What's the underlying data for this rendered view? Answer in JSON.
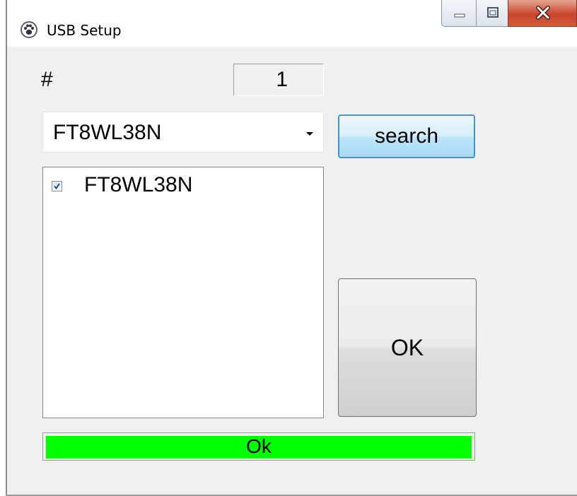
{
  "window": {
    "title": "USB Setup",
    "app_icon": "paw-print-icon",
    "controls": {
      "minimize_icon": "minimize-icon",
      "maximize_icon": "maximize-icon",
      "close_icon": "close-icon"
    }
  },
  "device_count": {
    "label": "#",
    "value": "1"
  },
  "device_select": {
    "selected": "FT8WL38N",
    "dropdown_icon": "chevron-down-icon"
  },
  "search_button": {
    "label": "search"
  },
  "device_list": {
    "items": [
      {
        "label": "FT8WL38N",
        "checked": true
      }
    ]
  },
  "ok_button": {
    "label": "OK"
  },
  "status": {
    "text": "Ok",
    "progress": 1.0,
    "color": "#00ff00"
  }
}
